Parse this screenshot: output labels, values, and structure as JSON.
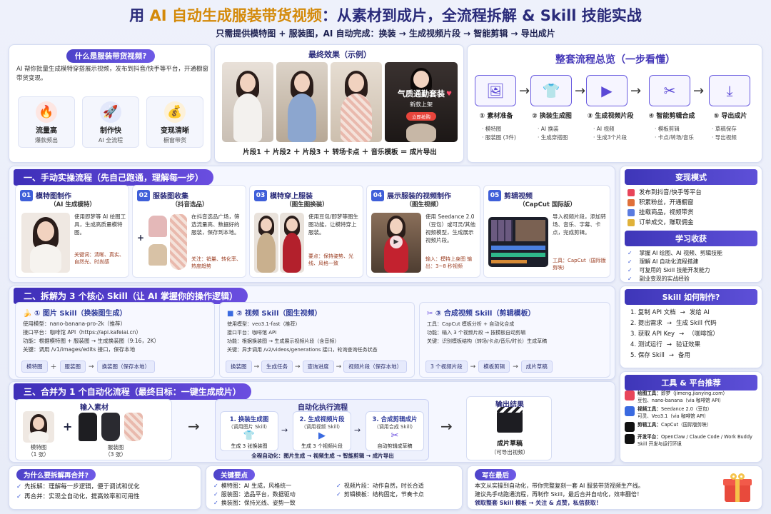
{
  "title": {
    "pre": "用 ",
    "ai": "AI 自动生成服装带货视频",
    "post": "：从素材到成片，全流程拆解 & Skill 技能实战"
  },
  "subtitle": "只需提供模特图 + 服装图，AI 自动完成：换装 → 生成视频片段 → 智能剪辑 → 导出成片",
  "intro": {
    "heading": "什么是服装带货视频?",
    "text": "AI 帮你批量生成模特穿搭展示视频，发布到抖音/快手等平台，开通橱窗带货变现。",
    "features": [
      {
        "icon": "🔥",
        "title": "流量高",
        "sub": "爆款频出"
      },
      {
        "icon": "🚀",
        "title": "制作快",
        "sub": "AI 全流程"
      },
      {
        "icon": "💰",
        "title": "变现清晰",
        "sub": "橱窗带货"
      }
    ]
  },
  "final": {
    "heading": "最终效果（示例）",
    "overlay_title": "气质通勤套装",
    "overlay_sub": "新款上架",
    "overlay_tag": "立即抢购",
    "formula": "片段1 ＋ 片段2 ＋ 片段3 ＋ 转场卡点 ＋ 音乐模板 ＝ 成片导出"
  },
  "overview": {
    "heading": "整套流程总览（一步看懂）",
    "steps": [
      {
        "icon": "🖼",
        "label": "① 素材准备",
        "subs": [
          "· 模特图",
          "· 服装图 (3件)"
        ]
      },
      {
        "icon": "👕",
        "label": "② 换装生成图",
        "subs": [
          "· AI 换装",
          "· 生成穿搭图"
        ]
      },
      {
        "icon": "▶",
        "label": "③ 生成视频片段",
        "subs": [
          "· AI 视频",
          "· 生成3个片段"
        ]
      },
      {
        "icon": "✂",
        "label": "④ 智能剪辑合成",
        "subs": [
          "· 模板剪辑",
          "· 卡点/转场/音乐"
        ]
      },
      {
        "icon": "⤓",
        "label": "⑤ 导出成片",
        "subs": [
          "· 草稿保存",
          "· 导出视频"
        ]
      }
    ]
  },
  "section1": {
    "heading": "一、手动实操流程（先自己跑通，理解每一步）",
    "steps": [
      {
        "num": "01",
        "title": "模特图制作",
        "sub": "（AI 生成模特）",
        "desc": "使用即梦等 AI 绘图工具，生成高质量模特图。",
        "note": "关键词：清晰、真实、自然光、时尚感"
      },
      {
        "num": "02",
        "title": "服装图收集",
        "sub": "（抖音选品）",
        "desc": "在抖音选品广场，筛选流量高、数据好的服装，保存到本地。",
        "note": "关注：销量、转化率、热度趋势"
      },
      {
        "num": "03",
        "title": "模特穿上服装",
        "sub": "（图生图换装）",
        "desc": "使用豆包/即梦等图生图功能，让模特穿上服装。",
        "note": "要点：保持姿势、光线、风格一致"
      },
      {
        "num": "04",
        "title": "展示服装的视频制作",
        "sub": "（图生视频）",
        "desc": "使用 Seedance 2.0（豆包）或可灵/其他视频模型，生成展示视频片段。",
        "note": "输入：模特上身图 输出：3~8 秒视频"
      },
      {
        "num": "05",
        "title": "剪辑视频",
        "sub": "（CapCut 国际版）",
        "desc": "导入视频片段，添加转场、音乐、字幕、卡点，完成剪辑。",
        "note": "工具：CapCut（国际版剪映）"
      }
    ]
  },
  "monetize": {
    "heading": "变现模式",
    "items": [
      "发布到抖音/快手等平台",
      "积累粉丝，开通橱窗",
      "挂载商品，视频带货",
      "订单成交，赚取佣金"
    ]
  },
  "learn": {
    "heading": "学习收获",
    "items": [
      "掌握 AI 绘图、AI 视频、剪辑技能",
      "理解 AI 自动化流程搭建",
      "可复用的 Skill 技能开发能力",
      "副业变现的实战经验"
    ]
  },
  "section2": {
    "heading": "二、拆解为 3 个核心 Skill（让 AI 掌握你的操作逻辑）",
    "skills": [
      {
        "title": "① 图片 Skill（换装图生成）",
        "lines": [
          "使用模型：nano-banana-pro-2k（推荐）",
          "接口平台：咖啡馆 API（https://api.kafeiai.cn）",
          "功能：根据模特图 + 服装图 → 生成换装图（9:16，2K）",
          "关键：调用 /v1/images/edits 接口，保存本地"
        ],
        "flow": [
          "模特图",
          "＋",
          "服装图",
          "→",
          "换装图（保存本地）"
        ]
      },
      {
        "title": "② 视频 Skill（图生视频）",
        "lines": [
          "使用模型：veo3.1-fast（推荐）",
          "接口平台：咖啡馆 API",
          "功能：根据换装图 → 生成展示视频片段（含音频）",
          "关键：异步调用 /v2/videos/generations 接口，轮询查询任务状态"
        ],
        "flow": [
          "换装图",
          "→",
          "生成任务",
          "→",
          "查询进度",
          "→",
          "视频片段（保存本地）"
        ]
      },
      {
        "title": "③ 合成视频 Skill（剪辑模板）",
        "lines": [
          "工具：CapCut 模板分析 + 自动化合成",
          "功能：输入 3 个视频片段 → 按模板自动剪辑",
          "关键：识别模板结构（转场/卡点/音乐/时长）生成草稿"
        ],
        "flow": [
          "3 个视频片段",
          "→",
          "模板剪辑",
          "→",
          "成片草稿"
        ]
      }
    ]
  },
  "skillhow": {
    "heading": "Skill 如何制作?",
    "items": [
      {
        "a": "1. 复制 API 文档",
        "b": "发给 AI"
      },
      {
        "a": "2. 提出需求",
        "b": "生成 Skill 代码"
      },
      {
        "a": "3. 获取 API Key",
        "b": "（咖啡馆）"
      },
      {
        "a": "4. 测试运行",
        "b": "验证效果"
      },
      {
        "a": "5. 保存 Skill",
        "b": "备用"
      }
    ]
  },
  "section3": {
    "heading": "三、合并为 1 个自动化流程（最终目标：一键生成成片）",
    "input_head": "输入素材",
    "model_label": "模特图",
    "model_count": "（1 张）",
    "clothes_label": "服装图",
    "clothes_count": "（3 张）",
    "auto_head": "自动化执行流程",
    "auto": [
      {
        "n": "1. 换装生成图",
        "s": "（调用图片 Skill）",
        "r": "生成 3 张换装图"
      },
      {
        "n": "2. 生成视频片段",
        "s": "（调用视频 Skill）",
        "r": "生成 3 个视频片段"
      },
      {
        "n": "3. 合成剪辑成片",
        "s": "（调用合成 Skill）",
        "r": "自动剪辑成草稿"
      }
    ],
    "chain": "全程自动化：图片生成 → 视频生成 → 智能剪辑 → 成片导出",
    "out_head": "输出结果",
    "out_label": "成片草稿",
    "out_sub": "（可导出视频）"
  },
  "tools": {
    "heading": "工具 & 平台推荐",
    "items": [
      {
        "label": "绘图工具：",
        "line1": "即梦（jimeng.jianying.com）",
        "line2": "豆包、nano-banana（via 咖啡馆 API）",
        "color": "#e8455a"
      },
      {
        "label": "视频工具：",
        "line1": "Seedance 2.0（豆包）",
        "line2": "可灵、Veo3.1（via 咖啡馆 API）",
        "color": "#3a6ae0"
      },
      {
        "label": "剪辑工具：",
        "line1": "CapCut（国际版剪映）",
        "line2": "",
        "color": "#111111"
      },
      {
        "label": "开发平台：",
        "line1": "OpenClaw / Claude Code / Work Buddy",
        "line2": "Skill 开发与运行环境",
        "color": "#111111"
      }
    ]
  },
  "why": {
    "heading": "为什么要拆解再合并?",
    "items": [
      "先拆解：理解每一步逻辑，便于调试和优化",
      "再合并：实现全自动化，提高效率和可用性"
    ]
  },
  "keys": {
    "heading": "关键要点",
    "left": [
      "模特图：AI 生成，风格统一",
      "服装图：选品平台，数据驱动",
      "换装图：保持光线、姿势一致"
    ],
    "right": [
      "视频片段：动作自然，时长合适",
      "剪辑模板：结构固定，节奏卡点"
    ]
  },
  "closing": {
    "heading": "写在最后",
    "lines": [
      "本文从实操到自动化，带你完整复刻一套 AI 服装带货视频生产线。",
      "建议先手动跑通流程，再制作 Skill，最后合并自动化，效率翻倍！",
      "领取整套 Skill 模板 → 关注 & 点赞，私信获取！"
    ]
  },
  "colors": {
    "accent": "#4d43c9",
    "title": "#2a2b7a",
    "gold": "#d48a0a"
  }
}
